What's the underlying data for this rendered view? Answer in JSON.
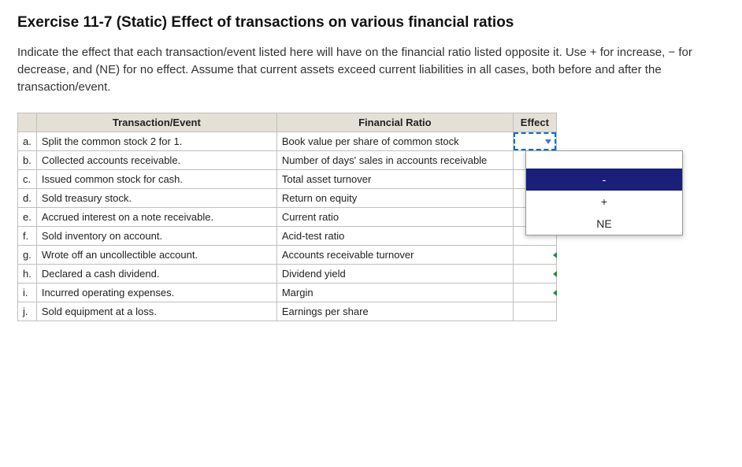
{
  "title": "Exercise 11-7 (Static) Effect of transactions on various financial ratios",
  "instructions": "Indicate the effect that each transaction/event listed here will have on the financial ratio listed opposite it. Use + for increase, − for decrease, and (NE) for no effect. Assume that current assets exceed current liabilities in all cases, both before and after the transaction/event.",
  "headers": {
    "transaction": "Transaction/Event",
    "ratio": "Financial Ratio",
    "effect": "Effect"
  },
  "rows": [
    {
      "letter": "a.",
      "transaction": "Split the common stock 2 for 1.",
      "ratio": "Book value per share of common stock",
      "effect": "",
      "active": true
    },
    {
      "letter": "b.",
      "transaction": "Collected accounts receivable.",
      "ratio": "Number of days' sales in accounts receivable",
      "effect": ""
    },
    {
      "letter": "c.",
      "transaction": "Issued common stock for cash.",
      "ratio": "Total asset turnover",
      "effect": ""
    },
    {
      "letter": "d.",
      "transaction": "Sold treasury stock.",
      "ratio": "Return on equity",
      "effect": ""
    },
    {
      "letter": "e.",
      "transaction": "Accrued interest on a note receivable.",
      "ratio": "Current ratio",
      "effect": ""
    },
    {
      "letter": "f.",
      "transaction": "Sold inventory on account.",
      "ratio": "Acid-test ratio",
      "effect": ""
    },
    {
      "letter": "g.",
      "transaction": "Wrote off an uncollectible account.",
      "ratio": "Accounts receivable turnover",
      "effect": "",
      "indicator": true
    },
    {
      "letter": "h.",
      "transaction": "Declared a cash dividend.",
      "ratio": "Dividend yield",
      "effect": "",
      "indicator": true
    },
    {
      "letter": "i.",
      "transaction": "Incurred operating expenses.",
      "ratio": "Margin",
      "effect": "",
      "indicator": true
    },
    {
      "letter": "j.",
      "transaction": "Sold equipment at a loss.",
      "ratio": "Earnings per share",
      "effect": ""
    }
  ],
  "dropdown": {
    "options": [
      {
        "label": "",
        "selected": false
      },
      {
        "label": "-",
        "selected": true
      },
      {
        "label": "+",
        "selected": false
      },
      {
        "label": "NE",
        "selected": false
      }
    ]
  }
}
